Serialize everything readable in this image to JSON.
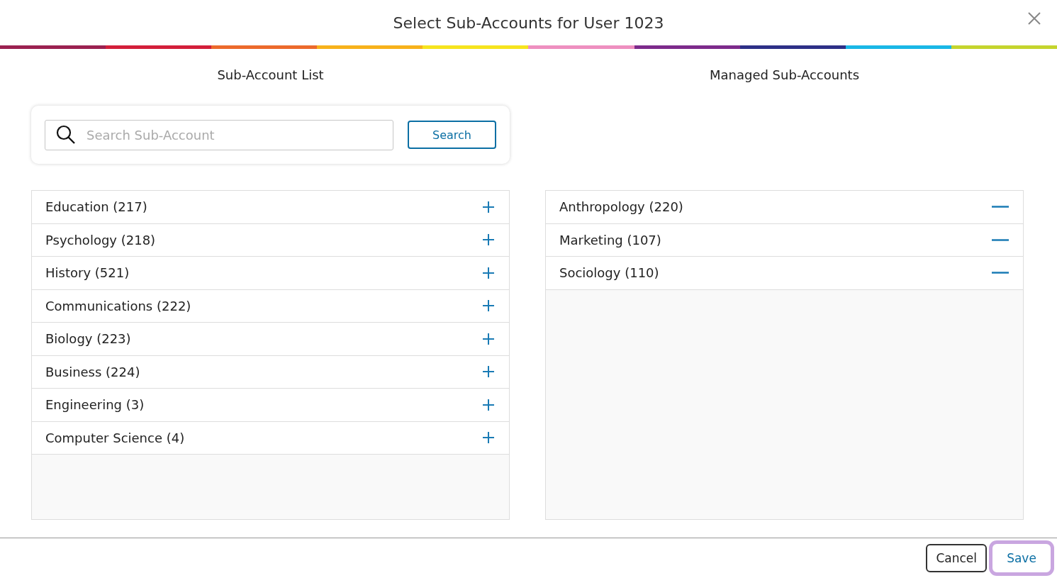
{
  "dialog": {
    "title": "Select Sub-Accounts for User 1023"
  },
  "stripe": [
    {
      "color": "#9b2150"
    },
    {
      "color": "#d31f3a"
    },
    {
      "color": "#ec6a2c"
    },
    {
      "color": "#f7b21b"
    },
    {
      "color": "#f6e41e"
    },
    {
      "color": "#ee8fc0"
    },
    {
      "color": "#7d2b8b"
    },
    {
      "color": "#2e3087"
    },
    {
      "color": "#1ab7e6"
    },
    {
      "color": "#c5d52e"
    }
  ],
  "available": {
    "heading": "Sub-Account List",
    "search": {
      "placeholder": "Search Sub-Account",
      "button": "Search"
    },
    "items": [
      {
        "label": "Education (217)"
      },
      {
        "label": "Psychology (218)"
      },
      {
        "label": "History (521)"
      },
      {
        "label": "Communications (222)"
      },
      {
        "label": "Biology (223)"
      },
      {
        "label": "Business (224)"
      },
      {
        "label": "Engineering (3)"
      },
      {
        "label": "Computer Science (4)"
      }
    ]
  },
  "managed": {
    "heading": "Managed Sub-Accounts",
    "items": [
      {
        "label": "Anthropology (220)"
      },
      {
        "label": "Marketing (107)"
      },
      {
        "label": "Sociology (110)"
      }
    ]
  },
  "buttons": [
    {
      "label": "Cancel",
      "kind": "secondary",
      "focused": false
    },
    {
      "label": "Save",
      "kind": "primary",
      "focused": true
    }
  ]
}
